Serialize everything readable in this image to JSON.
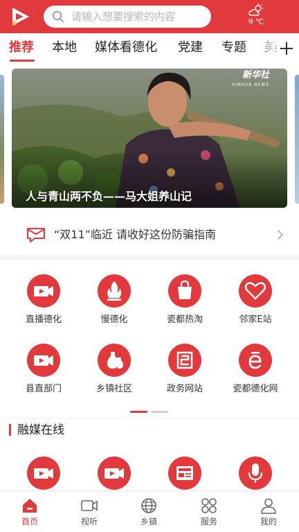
{
  "search": {
    "placeholder": "请输入想要搜索的内容"
  },
  "weather": {
    "temp": "9 ℃",
    "icon": "partly-cloudy-icon"
  },
  "tabs": [
    {
      "label": "推荐",
      "active": true
    },
    {
      "label": "本地"
    },
    {
      "label": "媒体看德化"
    },
    {
      "label": "党建"
    },
    {
      "label": "专题"
    },
    {
      "label": "美"
    }
  ],
  "banner": {
    "caption": "人与青山两不负——马大姐养山记",
    "watermark": "新华社",
    "watermark_sub": "XINHUA NEWS"
  },
  "notice": {
    "text": "“双11”临近 请收好这份防骗指南"
  },
  "grid": [
    {
      "label": "直播德化",
      "icon": "video-camera-icon"
    },
    {
      "label": "慢德化",
      "icon": "flame-icon"
    },
    {
      "label": "瓷都热淘",
      "icon": "shopping-bag-icon"
    },
    {
      "label": "邻家E站",
      "icon": "heart-icon"
    },
    {
      "label": "县直部门",
      "icon": "video-camera-icon"
    },
    {
      "label": "乡镇社区",
      "icon": "vase-icon"
    },
    {
      "label": "政务网站",
      "icon": "government-icon"
    },
    {
      "label": "瓷都德化网",
      "icon": "e-letter-icon"
    }
  ],
  "section": {
    "title": "融媒在线"
  },
  "media_icons": [
    "video-camera-icon",
    "video-camera-icon",
    "news-icon",
    "microphone-icon"
  ],
  "bottom_nav": [
    {
      "label": "首页",
      "icon": "home-icon",
      "active": true
    },
    {
      "label": "视听",
      "icon": "video-icon"
    },
    {
      "label": "乡镇",
      "icon": "globe-icon"
    },
    {
      "label": "服务",
      "icon": "grid-icon"
    },
    {
      "label": "我的",
      "icon": "user-icon"
    }
  ],
  "colors": {
    "primary": "#e23a3c"
  }
}
